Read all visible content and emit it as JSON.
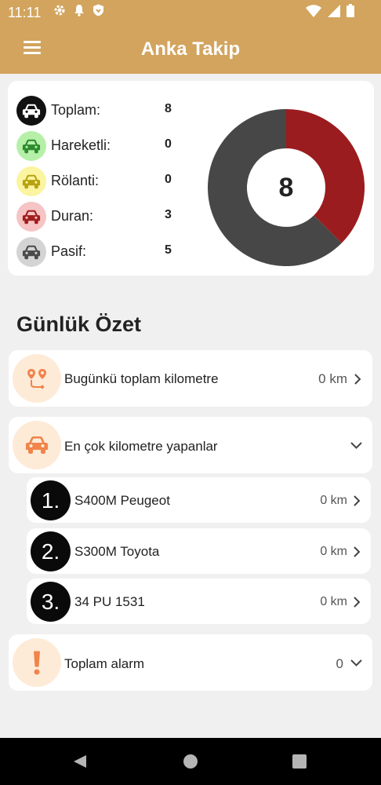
{
  "status": {
    "time": "11:11"
  },
  "header": {
    "title": "Anka Takip"
  },
  "stats": [
    {
      "label": "Toplam:",
      "value": "8",
      "icon": "car-icon",
      "color": "#111111",
      "bg": "#111111"
    },
    {
      "label": "Hareketli:",
      "value": "0",
      "icon": "car-icon",
      "color": "#2e8b2e",
      "bg": "#b6f0a8"
    },
    {
      "label": "Rölanti:",
      "value": "0",
      "icon": "car-icon",
      "color": "#b8a20f",
      "bg": "#fbf4a0"
    },
    {
      "label": "Duran:",
      "value": "3",
      "icon": "car-icon",
      "color": "#a01e1e",
      "bg": "#f6c4c4"
    },
    {
      "label": "Pasif:",
      "value": "5",
      "icon": "car-icon",
      "color": "#4a4a4a",
      "bg": "#d4d4d4"
    }
  ],
  "chart_data": {
    "type": "pie",
    "categories": [
      "Duran",
      "Pasif"
    ],
    "values": [
      3,
      5
    ],
    "colors": [
      "#9b1c1f",
      "#474747"
    ],
    "center_label": "8"
  },
  "summary": {
    "title": "Günlük Özet",
    "total_km": {
      "label": "Bugünkü toplam kilometre",
      "value": "0 km",
      "icon": "route-pins-icon"
    },
    "top_km": {
      "label": "En çok kilometre yapanlar",
      "icon": "car-icon"
    },
    "ranking": [
      {
        "rank": "1.",
        "name": "S400M Peugeot",
        "value": "0 km"
      },
      {
        "rank": "2.",
        "name": "S300M Toyota",
        "value": "0 km"
      },
      {
        "rank": "3.",
        "name": "34 PU 1531",
        "value": "0 km"
      }
    ],
    "alarm": {
      "label": "Toplam alarm",
      "value": "0",
      "icon": "exclamation-icon"
    }
  },
  "colors": {
    "header": "#d2a45e",
    "accent_icon": "#f0844b",
    "icon_bg": "#fdebd8"
  }
}
